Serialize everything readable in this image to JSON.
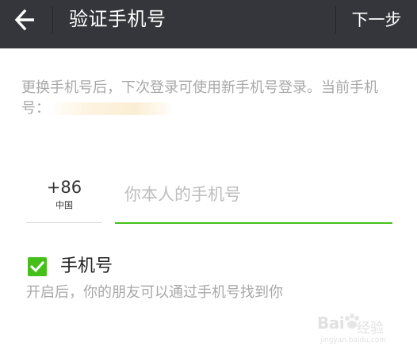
{
  "appbar": {
    "title": "验证手机号",
    "next_label": "下一步",
    "back_icon": "arrow-left-icon",
    "background": "#35363b"
  },
  "hint": {
    "text": "更换手机号后，下次登录可使用新手机号登录。当前手机号：",
    "masked_icon": "redacted-number"
  },
  "country": {
    "code": "+86",
    "name": "中国"
  },
  "phone": {
    "placeholder": "你本人的手机号",
    "value": "",
    "accent": "#45c01a"
  },
  "discoverable": {
    "checked": true,
    "label": "手机号",
    "description": "开启后，你的朋友可以通过手机号找到你",
    "accent": "#45c01a"
  },
  "watermark": {
    "brand": "Bai",
    "brand_suffix": "经验",
    "url": "jingyan.baidu.com"
  }
}
